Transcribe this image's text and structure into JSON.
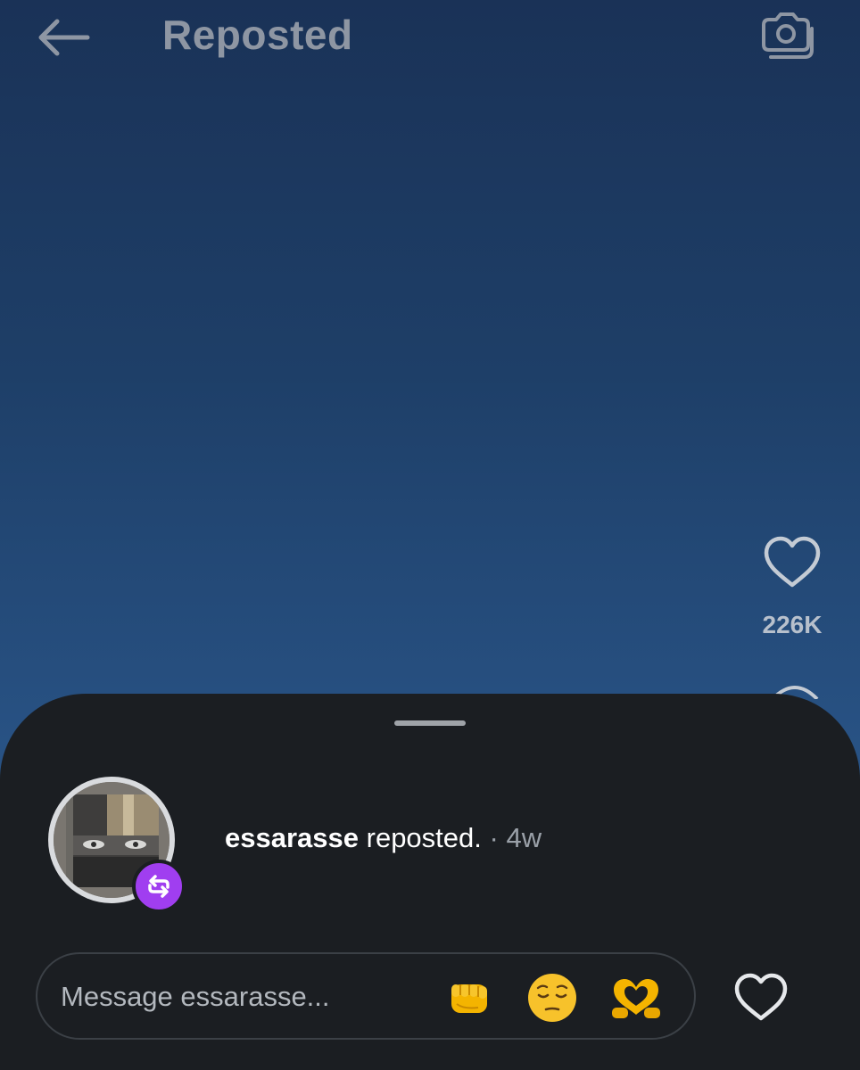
{
  "header": {
    "title": "Reposted",
    "back_icon": "back-arrow-icon",
    "camera_icon": "camera-icon"
  },
  "post": {
    "like_icon": "heart-outline-icon",
    "like_count": "226K"
  },
  "sheet": {
    "reposter": {
      "username": "essarasse",
      "action": "reposted.",
      "separator": "·",
      "time_ago": "4w",
      "badge_icon": "repost-icon"
    },
    "composer": {
      "placeholder": "Message essarasse...",
      "quick_reactions": [
        "fist-bump-emoji-icon",
        "pensive-face-emoji-icon",
        "heart-hands-emoji-icon"
      ]
    },
    "like_button_icon": "heart-outline-icon"
  },
  "colors": {
    "sheet_background": "#1b1e22",
    "badge": "#a03ef0",
    "sky_top": "#1a3257",
    "sky_bottom": "#2f5e93"
  }
}
